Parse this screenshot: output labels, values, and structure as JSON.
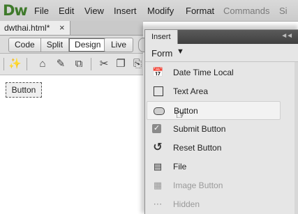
{
  "app": {
    "logo": "Dw"
  },
  "menu": [
    "File",
    "Edit",
    "View",
    "Insert",
    "Modify",
    "Format",
    "Commands",
    "Si"
  ],
  "document_tab": {
    "label": "dwthai.html*",
    "close": "×"
  },
  "view_buttons": [
    "Code",
    "Split",
    "Design",
    "Live"
  ],
  "active_view": "Design",
  "canvas": {
    "button_label": "Button"
  },
  "panel": {
    "title": "Insert",
    "category": "Form",
    "category_arrow": "▼",
    "items": [
      {
        "label": "Date Time Local",
        "icon": "calendar-clock-icon"
      },
      {
        "label": "Text Area",
        "icon": "textarea-icon"
      },
      {
        "label": "Button",
        "icon": "button-icon",
        "highlighted": true
      },
      {
        "label": "Submit Button",
        "icon": "checkbox-icon"
      },
      {
        "label": "Reset Button",
        "icon": "reset-icon"
      },
      {
        "label": "File",
        "icon": "file-icon"
      },
      {
        "label": "Image Button",
        "icon": "image-button-icon",
        "disabled": true
      },
      {
        "label": "Hidden",
        "icon": "hidden-field-icon",
        "disabled": true
      }
    ]
  },
  "colors": {
    "logo": "#3f7a2b",
    "panel_title_bar": "#4a4a4a",
    "panel_bg": "#e6e6e6"
  }
}
